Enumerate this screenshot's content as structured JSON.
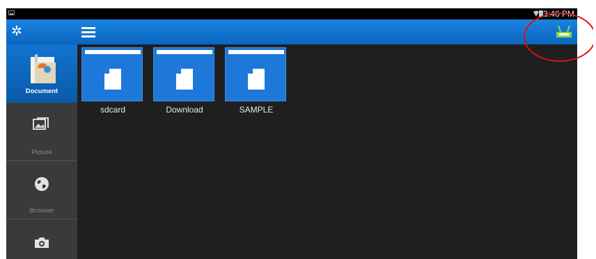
{
  "status_bar": {
    "time": "3:46 PM",
    "icons": [
      "screenshot-thumbnail-icon",
      "wifi-icon",
      "battery-icon"
    ]
  },
  "app_bar": {
    "left_icon": "gear-icon",
    "menu_icon": "hamburger-menu-icon",
    "right_icon": "printer-cast-icon"
  },
  "sidebar": {
    "items": [
      {
        "label": "Document",
        "icon": "document-folder-icon",
        "selected": true
      },
      {
        "label": "Picture",
        "icon": "picture-icon",
        "selected": false
      },
      {
        "label": "Browser",
        "icon": "globe-icon",
        "selected": false
      },
      {
        "label": "",
        "icon": "camera-icon",
        "selected": false
      }
    ]
  },
  "main": {
    "folders": [
      {
        "name": "sdcard",
        "icon": "file-icon"
      },
      {
        "name": "Download",
        "icon": "file-icon"
      },
      {
        "name": "SAMPLE",
        "icon": "file-icon"
      }
    ]
  },
  "colors": {
    "accent_blue": "#0a6fd0",
    "background": "#1f1f1f",
    "sidebar": "#3a3a3a",
    "highlight_ring": "#dd1111",
    "cast_icon": "#8bd64a"
  }
}
